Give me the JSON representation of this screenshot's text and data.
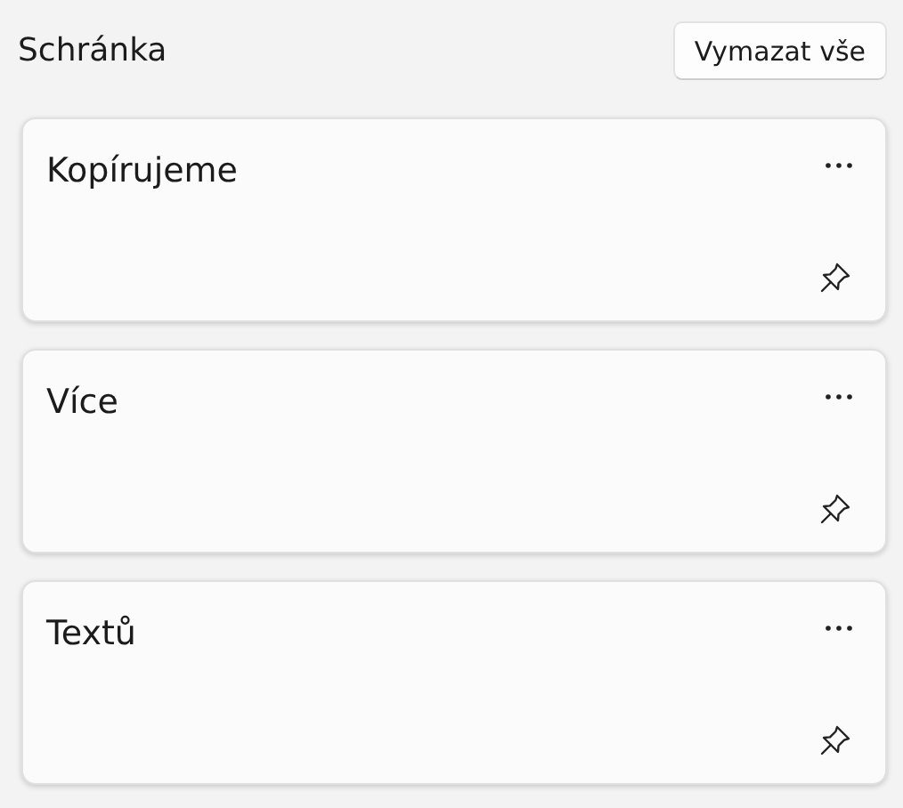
{
  "header": {
    "title": "Schránka",
    "clear_button": "Vymazat vše"
  },
  "items": [
    {
      "text": "Kopírujeme",
      "pinned": false
    },
    {
      "text": "Více",
      "pinned": false
    },
    {
      "text": "Textů",
      "pinned": false
    }
  ]
}
